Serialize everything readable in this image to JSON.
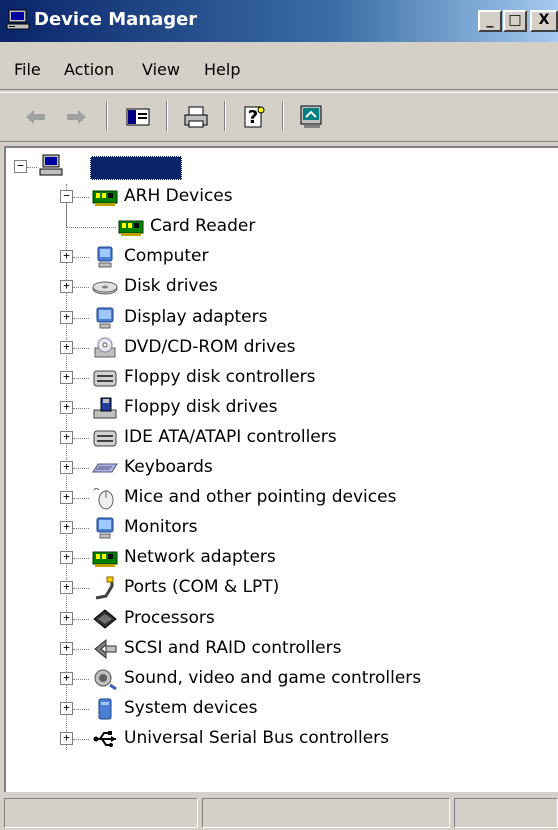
{
  "window": {
    "title": "Device Manager"
  },
  "titlebar": {
    "minimize_glyph": "_",
    "maximize_glyph": "□",
    "close_glyph": "X"
  },
  "menu": {
    "items": [
      "File",
      "Action",
      "View",
      "Help"
    ]
  },
  "toolbar": {
    "icons": [
      "back-arrow-icon",
      "forward-arrow-icon",
      "show-hide-console-tree-icon",
      "print-icon",
      "help-icon",
      "scan-hardware-icon"
    ]
  },
  "tree": {
    "root": {
      "label": "",
      "expanded": true
    },
    "categories": [
      {
        "label": "ARH Devices",
        "icon": "network-card-icon",
        "expanded": true,
        "children": [
          {
            "label": "Card Reader",
            "icon": "network-card-icon"
          }
        ]
      },
      {
        "label": "Computer",
        "icon": "computer-icon",
        "expanded": false
      },
      {
        "label": "Disk drives",
        "icon": "disk-drive-icon",
        "expanded": false
      },
      {
        "label": "Display adapters",
        "icon": "display-adapter-icon",
        "expanded": false
      },
      {
        "label": "DVD/CD-ROM drives",
        "icon": "cdrom-icon",
        "expanded": false
      },
      {
        "label": "Floppy disk controllers",
        "icon": "controller-icon",
        "expanded": false
      },
      {
        "label": "Floppy disk drives",
        "icon": "floppy-icon",
        "expanded": false
      },
      {
        "label": "IDE ATA/ATAPI controllers",
        "icon": "controller-icon",
        "expanded": false
      },
      {
        "label": "Keyboards",
        "icon": "keyboard-icon",
        "expanded": false
      },
      {
        "label": "Mice and other pointing devices",
        "icon": "mouse-icon",
        "expanded": false
      },
      {
        "label": "Monitors",
        "icon": "monitor-icon",
        "expanded": false
      },
      {
        "label": "Network adapters",
        "icon": "network-card-icon",
        "expanded": false
      },
      {
        "label": "Ports (COM & LPT)",
        "icon": "port-icon",
        "expanded": false
      },
      {
        "label": "Processors",
        "icon": "processor-icon",
        "expanded": false
      },
      {
        "label": "SCSI and RAID controllers",
        "icon": "scsi-icon",
        "expanded": false
      },
      {
        "label": "Sound, video and game controllers",
        "icon": "sound-icon",
        "expanded": false
      },
      {
        "label": "System devices",
        "icon": "system-icon",
        "expanded": false
      },
      {
        "label": "Universal Serial Bus controllers",
        "icon": "usb-icon",
        "expanded": false
      }
    ]
  },
  "colors": {
    "title_start": "#0a246a",
    "title_end": "#a6caf0",
    "face": "#d4d0c8",
    "selection": "#0a246a"
  }
}
